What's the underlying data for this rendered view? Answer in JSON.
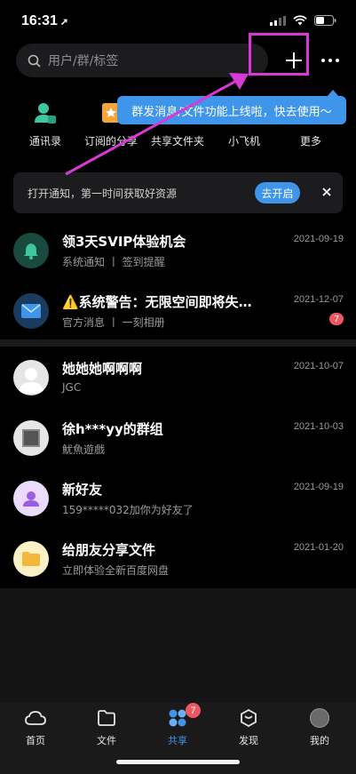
{
  "status_bar": {
    "time": "16:31"
  },
  "header": {
    "search_placeholder": "用户/群/标签"
  },
  "tooltip": {
    "text": "群发消息/文件功能上线啦，快去使用～"
  },
  "quick_actions": [
    {
      "label": "通讯录",
      "icon": "contacts-icon"
    },
    {
      "label": "订阅的分享",
      "icon": "subscribe-icon"
    },
    {
      "label": "共享文件夹",
      "icon": "shared-folder-icon"
    },
    {
      "label": "小飞机",
      "icon": "plane-icon"
    },
    {
      "label": "更多",
      "icon": "more-icon"
    }
  ],
  "notice": {
    "text": "打开通知，第一时间获取好资源",
    "button": "去开启"
  },
  "messages": [
    {
      "title": "领3天SVIP体验机会",
      "subtitle": "系统通知 丨 签到提醒",
      "date": "2021-09-19"
    },
    {
      "title": "⚠️系统警告：无限空间即将失…",
      "subtitle": "官方消息 丨 一刻相册",
      "date": "2021-12-07",
      "badge": "7"
    }
  ],
  "chats": [
    {
      "title": "她她她啊啊啊",
      "subtitle": "JGC",
      "date": "2021-10-07"
    },
    {
      "title": "徐h***yy的群组",
      "subtitle": "魷魚遊戲",
      "date": "2021-10-03"
    },
    {
      "title": "新好友",
      "subtitle": "159*****032加你为好友了",
      "date": "2021-09-19"
    },
    {
      "title": "给朋友分享文件",
      "subtitle": "立即体验全新百度网盘",
      "date": "2021-01-20"
    }
  ],
  "tabs": [
    {
      "label": "首页",
      "icon": "home-cloud-icon"
    },
    {
      "label": "文件",
      "icon": "folder-icon"
    },
    {
      "label": "共享",
      "icon": "share-icon",
      "badge": "7",
      "active": true
    },
    {
      "label": "发现",
      "icon": "discover-icon"
    },
    {
      "label": "我的",
      "icon": "profile-avatar-icon"
    }
  ],
  "colors": {
    "accent": "#3f95ea",
    "badge": "#f0565f",
    "annotation": "#d63ad3"
  }
}
